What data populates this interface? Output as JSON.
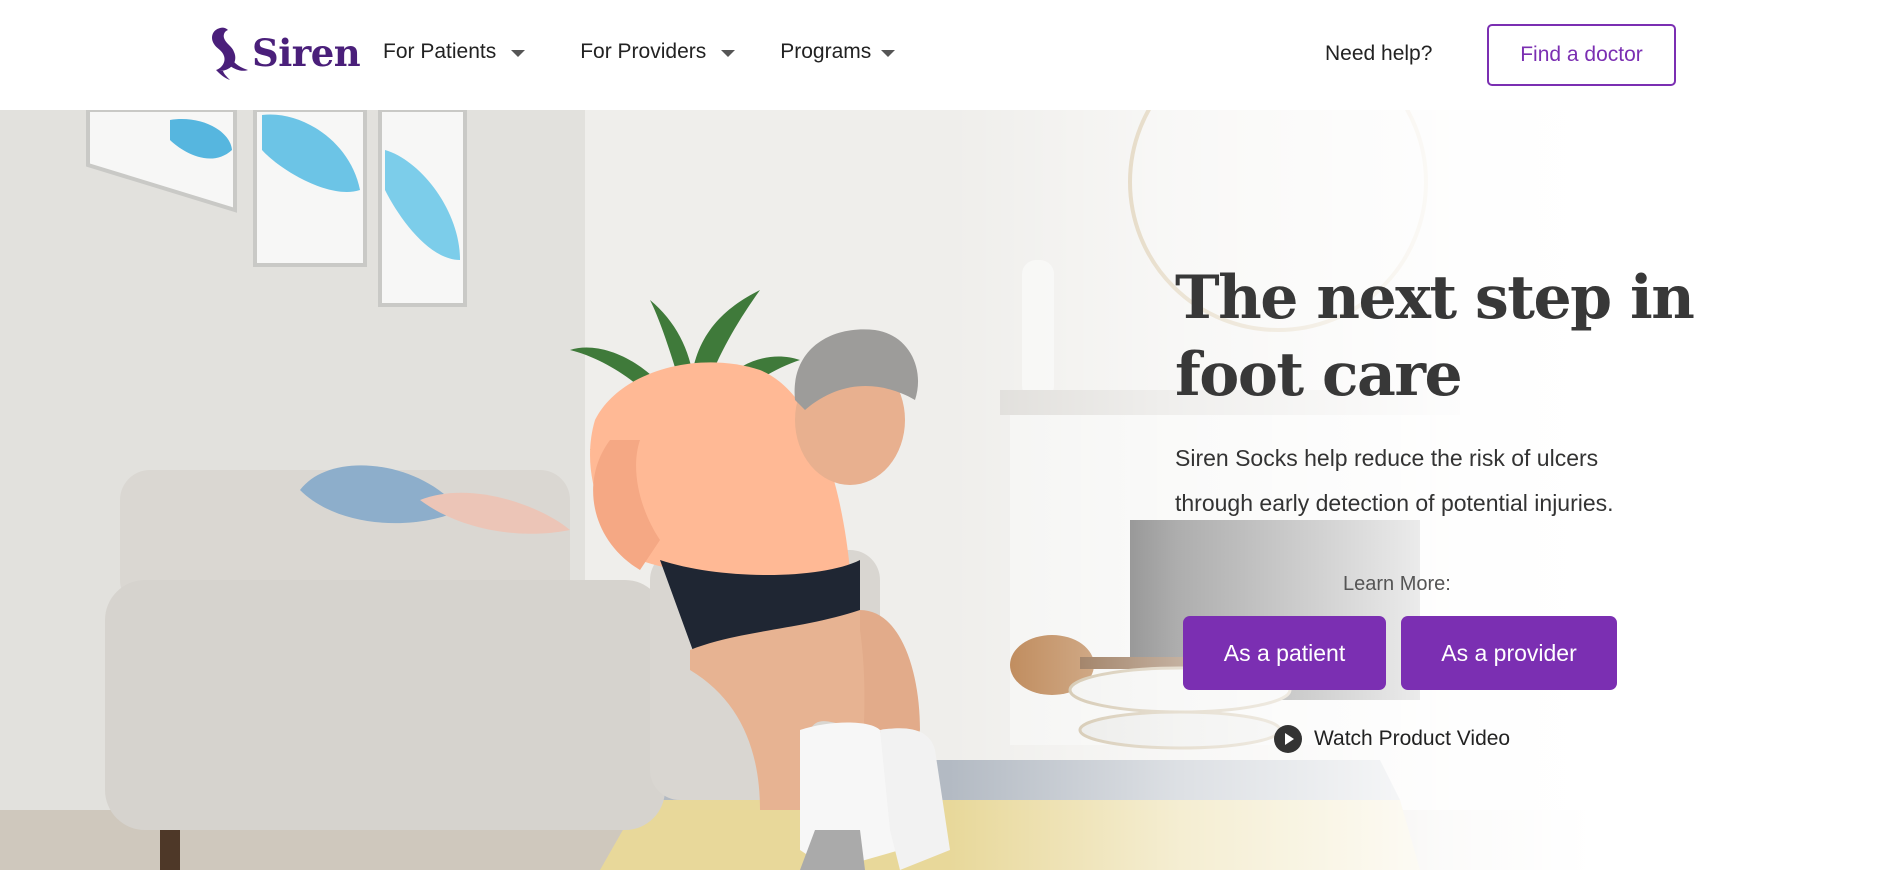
{
  "brand": {
    "name": "Siren",
    "color": "#4a1f7a",
    "accent": "#7b2fb2"
  },
  "nav": {
    "items": [
      {
        "label": "For Patients"
      },
      {
        "label": "For Providers"
      },
      {
        "label": "Programs"
      }
    ],
    "need_help": "Need help?",
    "find_doctor": "Find a doctor"
  },
  "hero": {
    "headline_line1": "The next step in",
    "headline_line2": "foot care",
    "subtext_line1": "Siren Socks help reduce the risk of ulcers",
    "subtext_line2": "through early detection of potential injuries.",
    "learn_more": "Learn More:",
    "cta_patient": "As a patient",
    "cta_provider": "As a provider",
    "video_link": "Watch Product Video"
  },
  "icons": [
    "mermaid-logo-icon",
    "chevron-down-icon",
    "play-icon"
  ]
}
